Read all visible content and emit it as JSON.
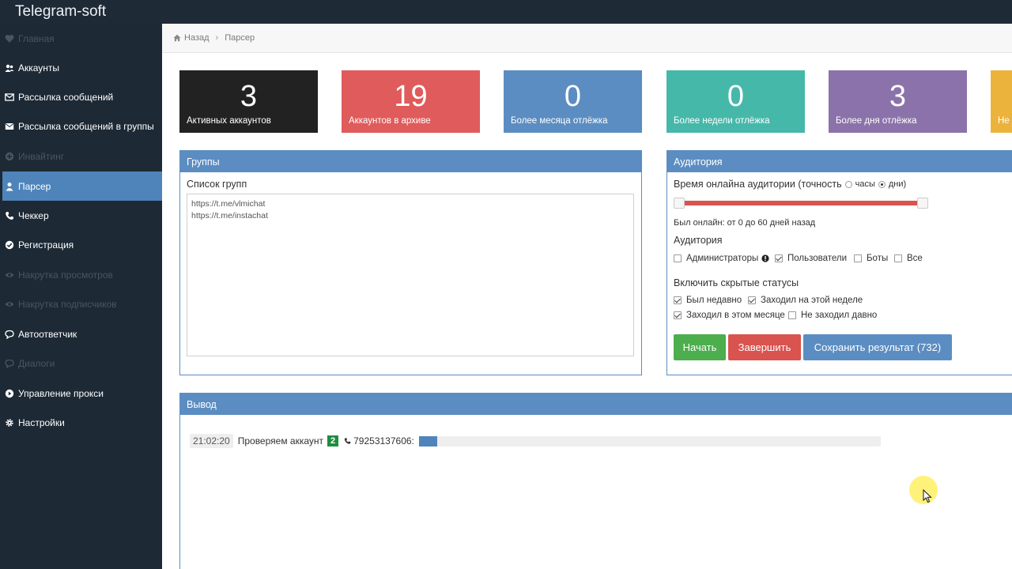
{
  "app": {
    "title": "Telegram-soft"
  },
  "sidebar": {
    "items": [
      {
        "label": "Главная",
        "icon": "heart-icon",
        "disabled": true
      },
      {
        "label": "Аккаунты",
        "icon": "users-icon",
        "disabled": false
      },
      {
        "label": "Рассылка сообщений",
        "icon": "envelope-icon",
        "disabled": false
      },
      {
        "label": "Рассылка сообщений в группы",
        "icon": "envelope-solid-icon",
        "disabled": false
      },
      {
        "label": "Инвайтинг",
        "icon": "plus-circle-icon",
        "disabled": true
      },
      {
        "label": "Парсер",
        "icon": "user-icon",
        "disabled": false,
        "active": true
      },
      {
        "label": "Чеккер",
        "icon": "phone-icon",
        "disabled": false
      },
      {
        "label": "Регистрация",
        "icon": "check-circle-icon",
        "disabled": false
      },
      {
        "label": "Накрутка просмотров",
        "icon": "eye-icon",
        "disabled": true
      },
      {
        "label": "Накрутка подписчиков",
        "icon": "eye-icon",
        "disabled": true
      },
      {
        "label": "Автоответчик",
        "icon": "comment-icon",
        "disabled": false
      },
      {
        "label": "Диалоги",
        "icon": "comment-icon",
        "disabled": true
      },
      {
        "label": "Управление прокси",
        "icon": "play-circle-icon",
        "disabled": false
      },
      {
        "label": "Настройки",
        "icon": "gear-icon",
        "disabled": false
      }
    ]
  },
  "breadcrumb": {
    "back": "Назад",
    "current": "Парсер"
  },
  "stats": [
    {
      "value": "3",
      "label": "Активных аккаунтов",
      "color": "#222222"
    },
    {
      "value": "19",
      "label": "Аккаунтов в архиве",
      "color": "#e05b5b"
    },
    {
      "value": "0",
      "label": "Более месяца отлёжка",
      "color": "#5b8dc2"
    },
    {
      "value": "0",
      "label": "Более недели отлёжка",
      "color": "#46b8aa"
    },
    {
      "value": "3",
      "label": "Более дня отлёжка",
      "color": "#8c72aa"
    },
    {
      "value": "",
      "label": "Не",
      "color": "#ecb33c"
    }
  ],
  "groups": {
    "title": "Группы",
    "list_label": "Список групп",
    "list": [
      "https://t.me/vlmichat",
      "https://t.me/instachat"
    ]
  },
  "audience": {
    "title": "Аудитория",
    "online_label": "Время онлайна аудитории (точность",
    "radio_hours": "часы",
    "radio_days": "дни)",
    "selected_precision": "дни",
    "online_text": "Был онлайн: от 0 до 60 дней назад",
    "section_audience": "Аудитория",
    "checks": {
      "admins": "Администраторы",
      "users": "Пользователи",
      "bots": "Боты",
      "all": "Все"
    },
    "section_hidden": "Включить скрытые статусы",
    "hidden": {
      "recently": "Был недавно",
      "week": "Заходил на этой неделе",
      "month": "Заходил в этом месяце",
      "long": "Не заходил давно"
    },
    "buttons": {
      "start": "Начать",
      "stop": "Завершить",
      "save": "Сохранить результат (732)"
    }
  },
  "output": {
    "title": "Вывод",
    "time": "21:02:20",
    "message": "Проверяем аккаунт",
    "badge": "2",
    "phone": "79253137606:",
    "progress_percent": 4
  }
}
